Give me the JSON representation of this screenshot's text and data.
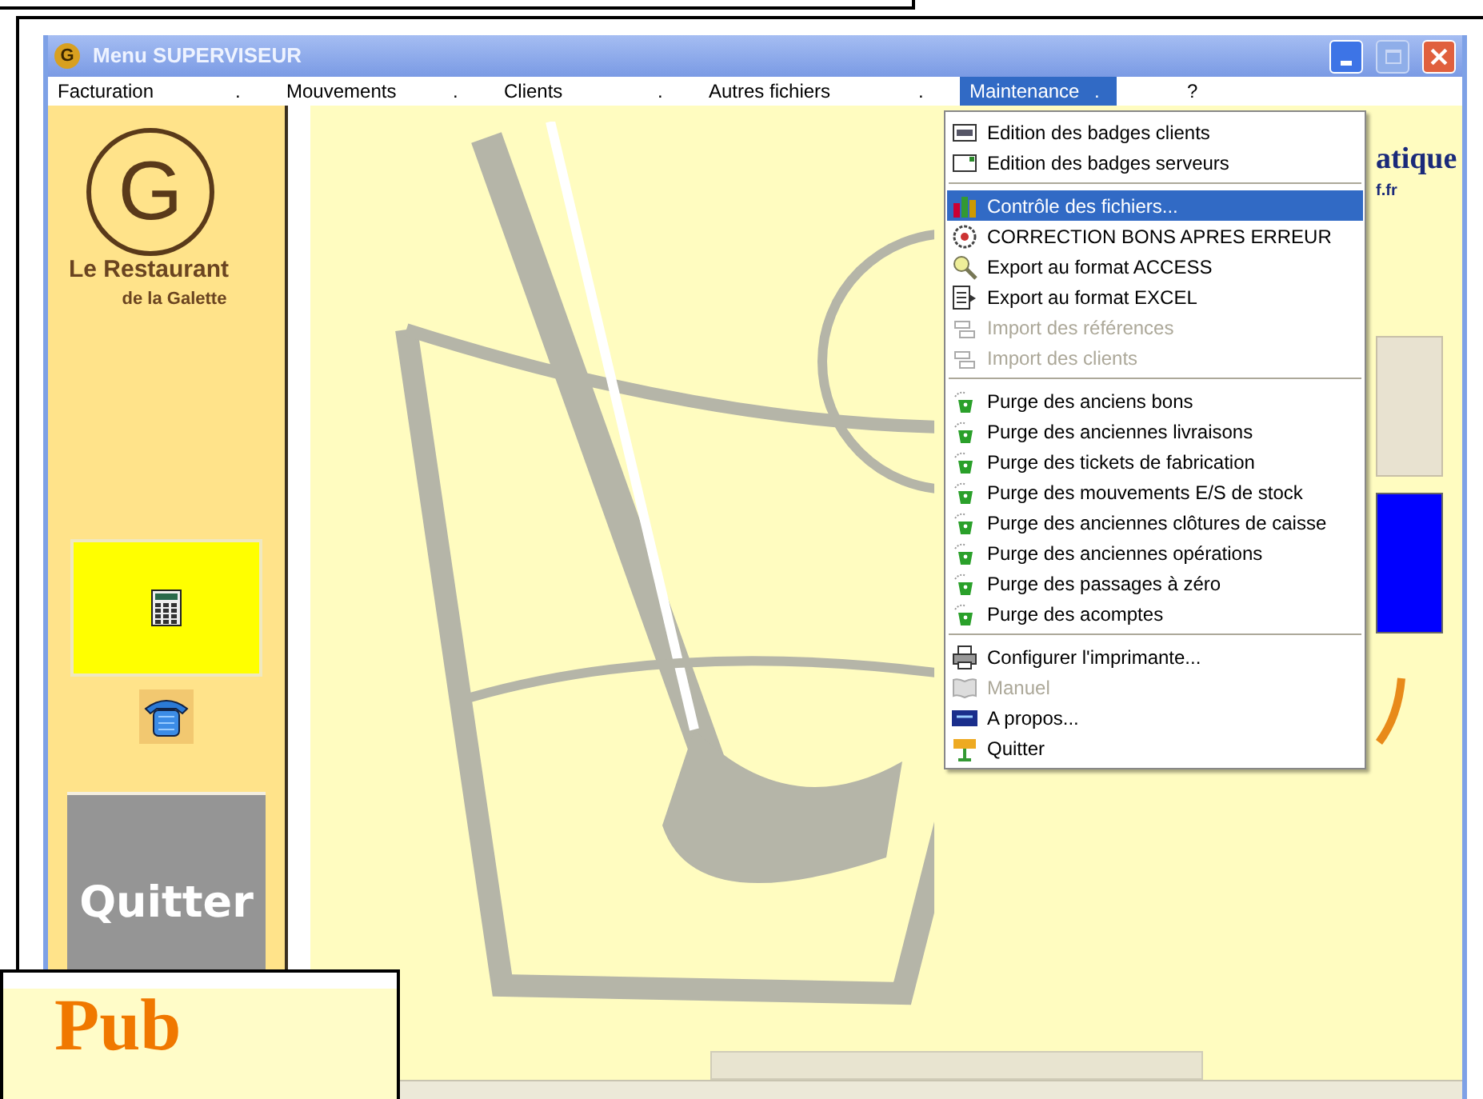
{
  "window": {
    "title": "Menu  SUPERVISEUR",
    "logo_letter": "G"
  },
  "menubar": [
    {
      "label": "Facturation",
      "selected": false,
      "dot": "."
    },
    {
      "label": "Mouvements",
      "selected": false,
      "dot": "."
    },
    {
      "label": "Clients",
      "selected": false,
      "dot": "."
    },
    {
      "label": "Autres fichiers",
      "selected": false,
      "dot": "."
    },
    {
      "label": "Maintenance",
      "selected": true,
      "dot": "."
    },
    {
      "label": "?",
      "selected": false
    }
  ],
  "dropdown": {
    "sections": [
      {
        "items": [
          {
            "label": "Edition des badges clients",
            "kind": "badge",
            "selected": false,
            "disabled": false
          },
          {
            "label": "Edition des badges serveurs",
            "kind": "card",
            "selected": false,
            "disabled": false
          }
        ]
      },
      {
        "items": [
          {
            "label": "Contrôle des fichiers...",
            "kind": "chart",
            "selected": true,
            "disabled": false
          },
          {
            "label": "CORRECTION BONS APRES ERREUR",
            "kind": "gear",
            "selected": false,
            "disabled": false
          },
          {
            "label": "Export au format ACCESS",
            "kind": "key",
            "selected": false,
            "disabled": false
          },
          {
            "label": "Export au format EXCEL",
            "kind": "export",
            "selected": false,
            "disabled": false
          },
          {
            "label": "Import des références",
            "kind": "import",
            "selected": false,
            "disabled": true
          },
          {
            "label": "Import des clients",
            "kind": "import",
            "selected": false,
            "disabled": true
          }
        ]
      },
      {
        "items": [
          {
            "label": "Purge des anciens bons",
            "kind": "purge",
            "selected": false,
            "disabled": false
          },
          {
            "label": "Purge des anciennes livraisons",
            "kind": "purge",
            "selected": false,
            "disabled": false
          },
          {
            "label": "Purge des tickets de fabrication",
            "kind": "purge",
            "selected": false,
            "disabled": false
          },
          {
            "label": "Purge des mouvements E/S de stock",
            "kind": "purge",
            "selected": false,
            "disabled": false
          },
          {
            "label": "Purge des anciennes clôtures de caisse",
            "kind": "purge",
            "selected": false,
            "disabled": false
          },
          {
            "label": "Purge des anciennes opérations",
            "kind": "purge",
            "selected": false,
            "disabled": false
          },
          {
            "label": "Purge des passages à zéro",
            "kind": "purge",
            "selected": false,
            "disabled": false
          },
          {
            "label": "Purge des acomptes",
            "kind": "purge",
            "selected": false,
            "disabled": false
          }
        ]
      },
      {
        "items": [
          {
            "label": "Configurer l'imprimante...",
            "kind": "printer",
            "selected": false,
            "disabled": false
          },
          {
            "label": "Manuel",
            "kind": "book",
            "selected": false,
            "disabled": true
          },
          {
            "label": "A propos...",
            "kind": "about",
            "selected": false,
            "disabled": false
          },
          {
            "label": "Quitter",
            "kind": "exit",
            "selected": false,
            "disabled": false
          }
        ]
      }
    ]
  },
  "sidebar": {
    "logo_letter": "G",
    "name_line1": "Le Restaurant",
    "name_line2": "de la Galette",
    "quit_button": "Quitter"
  },
  "main": {
    "partial_title": "atique",
    "partial_link": "f.fr"
  },
  "ad": {
    "text": "Pub"
  }
}
